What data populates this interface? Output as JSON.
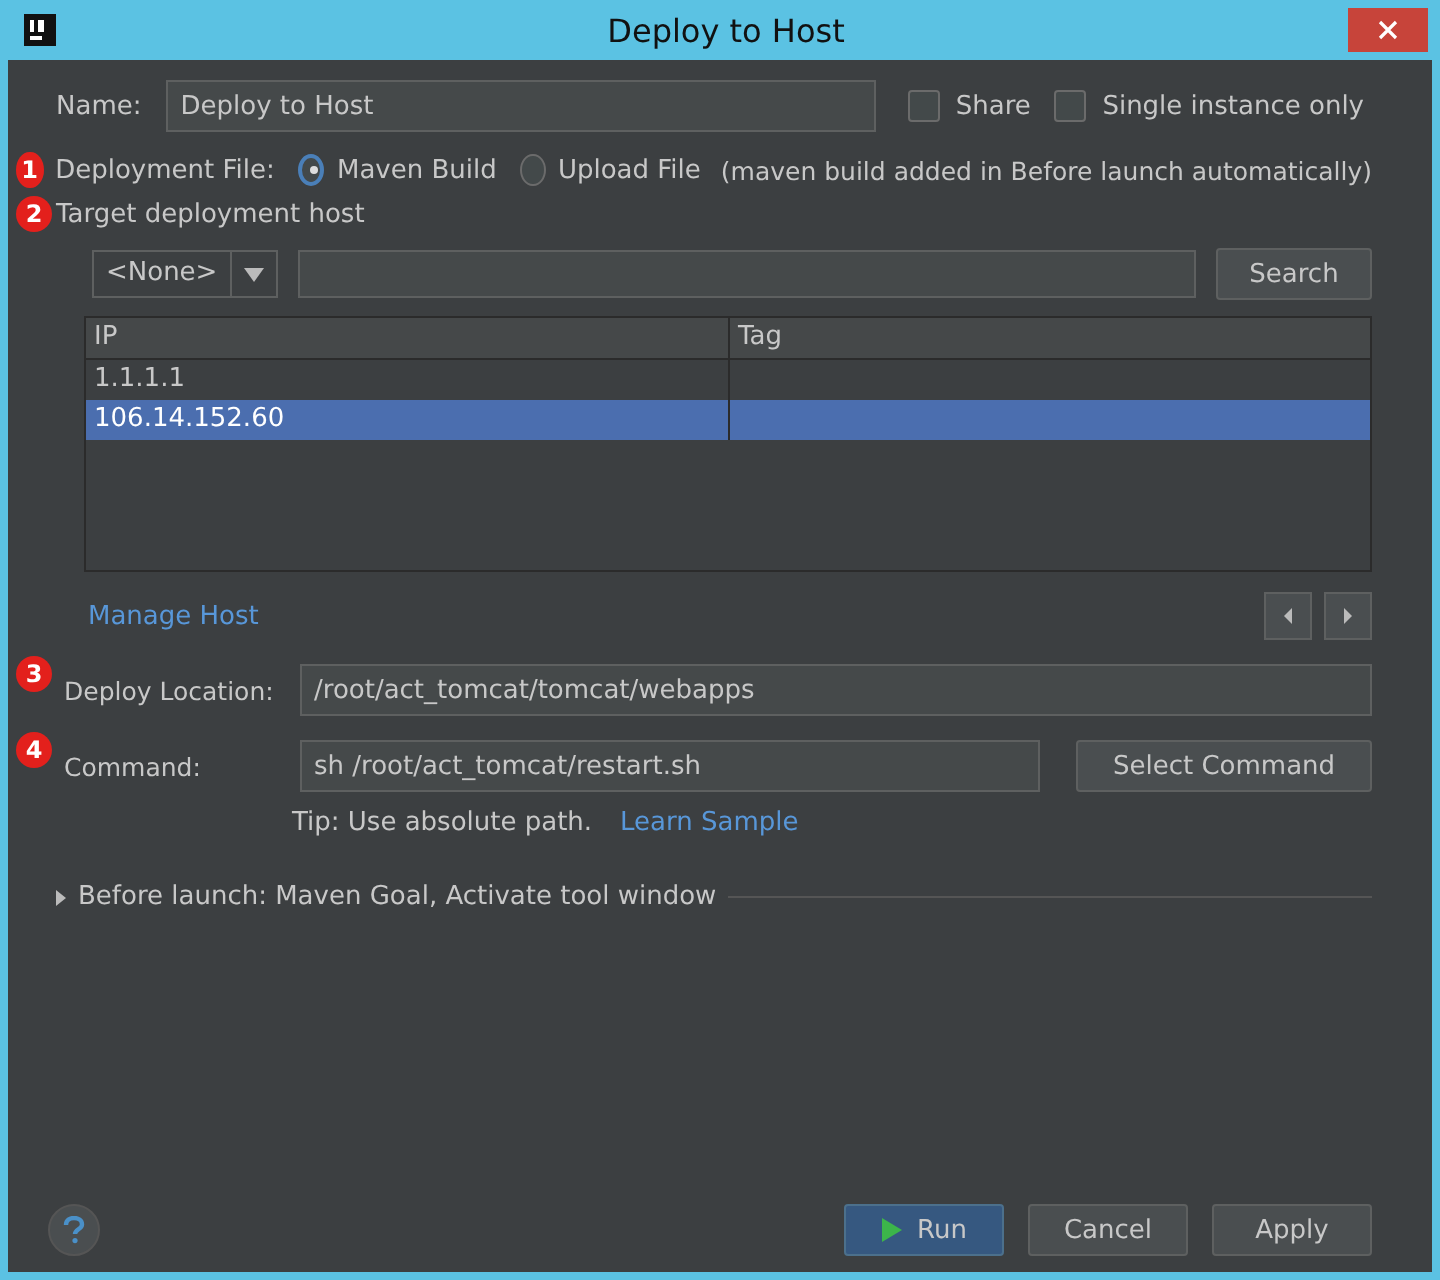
{
  "window": {
    "title": "Deploy to Host"
  },
  "name_field": {
    "label": "Name:",
    "value": "Deploy to Host"
  },
  "options": [
    {
      "label": "Share",
      "checked": false
    },
    {
      "label": "Single instance only",
      "checked": false
    }
  ],
  "deployment_file": {
    "badge": "1",
    "label": "Deployment File:",
    "choices": [
      {
        "label": "Maven Build",
        "selected": true
      },
      {
        "label": "Upload File",
        "selected": false
      }
    ],
    "note": "(maven build added in Before launch automatically)"
  },
  "target": {
    "badge": "2",
    "label": "Target deployment host",
    "filter": "<None>",
    "search_button": "Search"
  },
  "table": {
    "columns": [
      "IP",
      "Tag"
    ],
    "rows": [
      {
        "cells": [
          "1.1.1.1",
          ""
        ],
        "selected": false
      },
      {
        "cells": [
          "106.14.152.60",
          ""
        ],
        "selected": true
      }
    ]
  },
  "manage_host_link": "Manage Host",
  "deploy_location": {
    "badge": "3",
    "label": "Deploy Location:",
    "value": "/root/act_tomcat/tomcat/webapps"
  },
  "command": {
    "badge": "4",
    "label": "Command:",
    "value": "sh /root/act_tomcat/restart.sh",
    "button": "Select Command"
  },
  "tip": {
    "text": "Tip: Use absolute path.",
    "link": "Learn Sample"
  },
  "before_launch": {
    "label": "Before launch: Maven Goal, Activate tool window",
    "expanded": false
  },
  "buttons": [
    {
      "label": "Run",
      "kind": "primary"
    },
    {
      "label": "Cancel",
      "kind": "plain"
    },
    {
      "label": "Apply",
      "kind": "plain"
    }
  ]
}
